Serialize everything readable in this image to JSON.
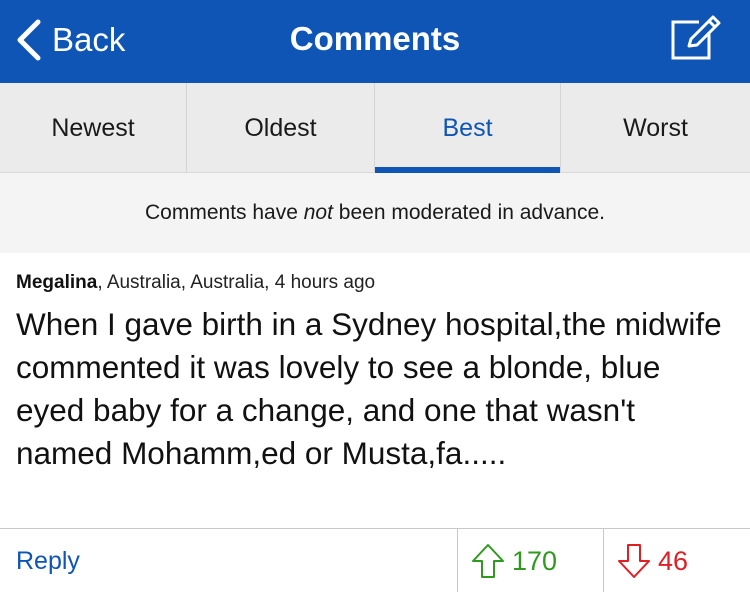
{
  "header": {
    "back_label": "Back",
    "title": "Comments",
    "color": "#0f55b5"
  },
  "tabs": [
    {
      "label": "Newest",
      "active": false
    },
    {
      "label": "Oldest",
      "active": false
    },
    {
      "label": "Best",
      "active": true
    },
    {
      "label": "Worst",
      "active": false
    }
  ],
  "notice": {
    "prefix": "Comments have ",
    "emphasis": "not",
    "suffix": " been moderated in advance."
  },
  "comment": {
    "author": "Megalina",
    "location_time": ", Australia, Australia, 4 hours ago",
    "text": "When I gave birth in a Sydney hospital,the midwife commented it was lovely to see a blonde, blue eyed baby for a change, and one that wasn't named Mohamm,ed or Musta,fa.....",
    "reply_label": "Reply",
    "upvotes": "170",
    "downvotes": "46",
    "upvote_color": "#2f9a1f",
    "downvote_color": "#e01e24"
  },
  "icons": {
    "back": "chevron-left-icon",
    "compose": "compose-icon",
    "upvote": "arrow-up-icon",
    "downvote": "arrow-down-icon"
  }
}
